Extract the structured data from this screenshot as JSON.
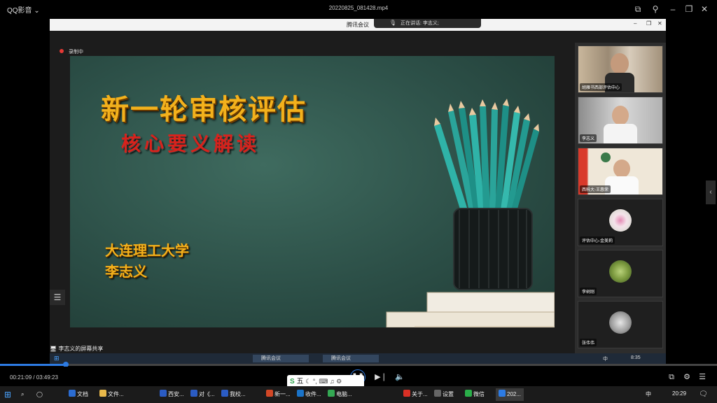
{
  "player": {
    "app_name": "QQ影音",
    "file_title": "20220825_081428.mp4",
    "time_display": "00:21:09 / 03:49:23",
    "progress": 0.092
  },
  "meeting": {
    "window_title": "腾讯会议",
    "speaking_label": "正在讲话: 李志义;",
    "recording_label": "录制中",
    "share_label": "李志义的屏幕共享"
  },
  "slide": {
    "title": "新一轮审核评估",
    "subtitle": "核心要义解读",
    "organization": "大连理工大学",
    "presenter": "李志义"
  },
  "participants": [
    {
      "name": "胡雁书西部评估中心",
      "kind": "video"
    },
    {
      "name": "李志义",
      "kind": "video"
    },
    {
      "name": "西科大-王惠荣",
      "kind": "video"
    },
    {
      "name": "评估中心-金美莉",
      "kind": "avatar"
    },
    {
      "name": "李树刚",
      "kind": "avatar"
    },
    {
      "name": "张伟伟",
      "kind": "avatar"
    }
  ],
  "video_taskbar": {
    "apps": [
      "腾讯会议",
      "腾讯会议"
    ],
    "time": "8:35",
    "ime_label": "中"
  },
  "taskbar": {
    "items": [
      "文档",
      "文件...",
      "西安...",
      "对《...",
      "我校...",
      "新一...",
      "收件...",
      "电脑...",
      "关于...",
      "设置",
      "微信",
      "202..."
    ],
    "ime_label": "中",
    "clock": "20:29"
  },
  "ime_bar": {
    "label": "五"
  },
  "colors": {
    "accent": "#2d7be3",
    "slide_title": "#f3b11c",
    "slide_subtitle": "#d8221c",
    "chalkboard": "#2c4f47"
  }
}
